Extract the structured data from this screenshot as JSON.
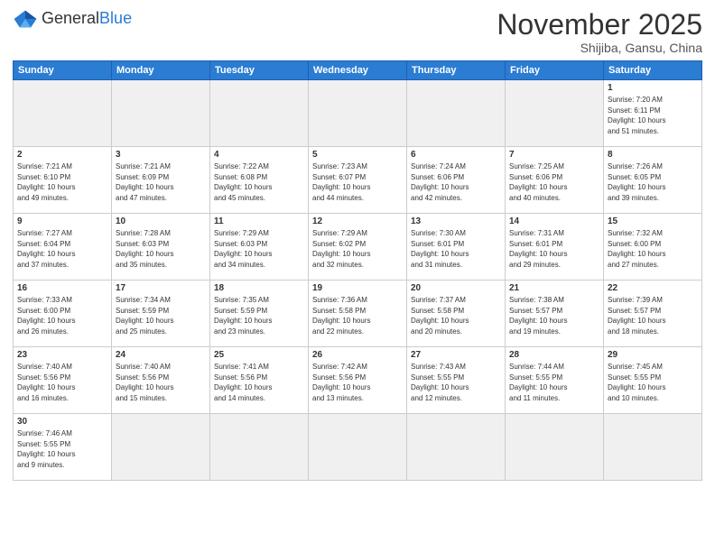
{
  "logo": {
    "text_general": "General",
    "text_blue": "Blue"
  },
  "header": {
    "month_title": "November 2025",
    "subtitle": "Shijiba, Gansu, China"
  },
  "weekdays": [
    "Sunday",
    "Monday",
    "Tuesday",
    "Wednesday",
    "Thursday",
    "Friday",
    "Saturday"
  ],
  "weeks": [
    [
      {
        "day": "",
        "empty": true
      },
      {
        "day": "",
        "empty": true
      },
      {
        "day": "",
        "empty": true
      },
      {
        "day": "",
        "empty": true
      },
      {
        "day": "",
        "empty": true
      },
      {
        "day": "",
        "empty": true
      },
      {
        "day": "1",
        "info": "Sunrise: 7:20 AM\nSunset: 6:11 PM\nDaylight: 10 hours\nand 51 minutes."
      }
    ],
    [
      {
        "day": "2",
        "info": "Sunrise: 7:21 AM\nSunset: 6:10 PM\nDaylight: 10 hours\nand 49 minutes."
      },
      {
        "day": "3",
        "info": "Sunrise: 7:21 AM\nSunset: 6:09 PM\nDaylight: 10 hours\nand 47 minutes."
      },
      {
        "day": "4",
        "info": "Sunrise: 7:22 AM\nSunset: 6:08 PM\nDaylight: 10 hours\nand 45 minutes."
      },
      {
        "day": "5",
        "info": "Sunrise: 7:23 AM\nSunset: 6:07 PM\nDaylight: 10 hours\nand 44 minutes."
      },
      {
        "day": "6",
        "info": "Sunrise: 7:24 AM\nSunset: 6:06 PM\nDaylight: 10 hours\nand 42 minutes."
      },
      {
        "day": "7",
        "info": "Sunrise: 7:25 AM\nSunset: 6:06 PM\nDaylight: 10 hours\nand 40 minutes."
      },
      {
        "day": "8",
        "info": "Sunrise: 7:26 AM\nSunset: 6:05 PM\nDaylight: 10 hours\nand 39 minutes."
      }
    ],
    [
      {
        "day": "9",
        "info": "Sunrise: 7:27 AM\nSunset: 6:04 PM\nDaylight: 10 hours\nand 37 minutes."
      },
      {
        "day": "10",
        "info": "Sunrise: 7:28 AM\nSunset: 6:03 PM\nDaylight: 10 hours\nand 35 minutes."
      },
      {
        "day": "11",
        "info": "Sunrise: 7:29 AM\nSunset: 6:03 PM\nDaylight: 10 hours\nand 34 minutes."
      },
      {
        "day": "12",
        "info": "Sunrise: 7:29 AM\nSunset: 6:02 PM\nDaylight: 10 hours\nand 32 minutes."
      },
      {
        "day": "13",
        "info": "Sunrise: 7:30 AM\nSunset: 6:01 PM\nDaylight: 10 hours\nand 31 minutes."
      },
      {
        "day": "14",
        "info": "Sunrise: 7:31 AM\nSunset: 6:01 PM\nDaylight: 10 hours\nand 29 minutes."
      },
      {
        "day": "15",
        "info": "Sunrise: 7:32 AM\nSunset: 6:00 PM\nDaylight: 10 hours\nand 27 minutes."
      }
    ],
    [
      {
        "day": "16",
        "info": "Sunrise: 7:33 AM\nSunset: 6:00 PM\nDaylight: 10 hours\nand 26 minutes."
      },
      {
        "day": "17",
        "info": "Sunrise: 7:34 AM\nSunset: 5:59 PM\nDaylight: 10 hours\nand 25 minutes."
      },
      {
        "day": "18",
        "info": "Sunrise: 7:35 AM\nSunset: 5:59 PM\nDaylight: 10 hours\nand 23 minutes."
      },
      {
        "day": "19",
        "info": "Sunrise: 7:36 AM\nSunset: 5:58 PM\nDaylight: 10 hours\nand 22 minutes."
      },
      {
        "day": "20",
        "info": "Sunrise: 7:37 AM\nSunset: 5:58 PM\nDaylight: 10 hours\nand 20 minutes."
      },
      {
        "day": "21",
        "info": "Sunrise: 7:38 AM\nSunset: 5:57 PM\nDaylight: 10 hours\nand 19 minutes."
      },
      {
        "day": "22",
        "info": "Sunrise: 7:39 AM\nSunset: 5:57 PM\nDaylight: 10 hours\nand 18 minutes."
      }
    ],
    [
      {
        "day": "23",
        "info": "Sunrise: 7:40 AM\nSunset: 5:56 PM\nDaylight: 10 hours\nand 16 minutes."
      },
      {
        "day": "24",
        "info": "Sunrise: 7:40 AM\nSunset: 5:56 PM\nDaylight: 10 hours\nand 15 minutes."
      },
      {
        "day": "25",
        "info": "Sunrise: 7:41 AM\nSunset: 5:56 PM\nDaylight: 10 hours\nand 14 minutes."
      },
      {
        "day": "26",
        "info": "Sunrise: 7:42 AM\nSunset: 5:56 PM\nDaylight: 10 hours\nand 13 minutes."
      },
      {
        "day": "27",
        "info": "Sunrise: 7:43 AM\nSunset: 5:55 PM\nDaylight: 10 hours\nand 12 minutes."
      },
      {
        "day": "28",
        "info": "Sunrise: 7:44 AM\nSunset: 5:55 PM\nDaylight: 10 hours\nand 11 minutes."
      },
      {
        "day": "29",
        "info": "Sunrise: 7:45 AM\nSunset: 5:55 PM\nDaylight: 10 hours\nand 10 minutes."
      }
    ],
    [
      {
        "day": "30",
        "info": "Sunrise: 7:46 AM\nSunset: 5:55 PM\nDaylight: 10 hours\nand 9 minutes."
      },
      {
        "day": "",
        "empty": true
      },
      {
        "day": "",
        "empty": true
      },
      {
        "day": "",
        "empty": true
      },
      {
        "day": "",
        "empty": true
      },
      {
        "day": "",
        "empty": true
      },
      {
        "day": "",
        "empty": true
      }
    ]
  ]
}
